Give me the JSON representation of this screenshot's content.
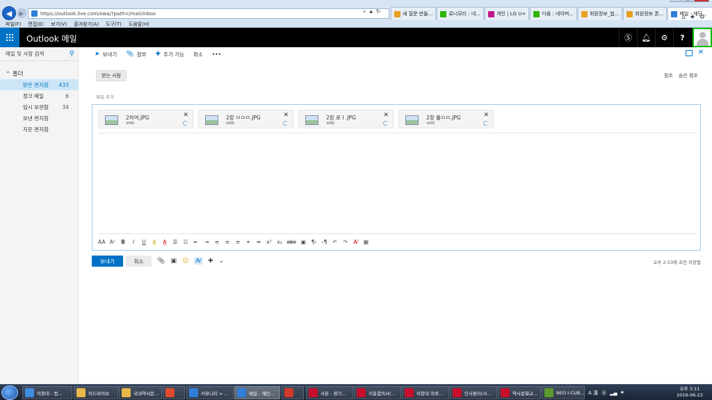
{
  "browser": {
    "url": "https://outlook.live.com/owa/?path=/mail/inbox",
    "menu": [
      "파일(F)",
      "편집(E)",
      "보기(V)",
      "즐겨찾기(A)",
      "도구(T)",
      "도움말(H)"
    ],
    "tabs": [
      {
        "label": "새 질문 만들...",
        "color": "#e8a020"
      },
      {
        "label": "로니모리 : 네...",
        "color": "#2db400"
      },
      {
        "label": "개인 | LG U+",
        "color": "#c0168b"
      },
      {
        "label": "다음 : 네이버...",
        "color": "#2db400"
      },
      {
        "label": "회원정보_법...",
        "color": "#e8a020"
      },
      {
        "label": "회원정보 폰...",
        "color": "#e8a020"
      },
      {
        "label": "메일 - 재단...",
        "color": "#2f7fd8",
        "active": true
      }
    ]
  },
  "header": {
    "title": "Outlook 메일",
    "help_label": "?"
  },
  "sidebar": {
    "search_placeholder": "메일 및 사람 검색",
    "folders_label": "폴더",
    "folders": [
      {
        "label": "받은 편지함",
        "count": "433",
        "selected": true
      },
      {
        "label": "정크 메일",
        "count": "6"
      },
      {
        "label": "임시 보관함",
        "count": "34"
      },
      {
        "label": "보낸 편지함",
        "count": ""
      },
      {
        "label": "지운 편지함",
        "count": ""
      }
    ]
  },
  "toolbar": {
    "send": "보내기",
    "attach": "첨부",
    "add_feature": "추가 기능",
    "cancel": "취소",
    "more": "•••"
  },
  "compose": {
    "to_label": "받는 사람",
    "cc": "참조",
    "bcc": "숨은 참조",
    "subject_placeholder": "제목 추가",
    "attachments": [
      {
        "name": "2차여.JPG",
        "size": "4MB"
      },
      {
        "name": "2장 ㅁㅁㅁ.JPG",
        "size": "4MB"
      },
      {
        "name": "2장 로 I .JPG",
        "size": "4MB"
      },
      {
        "name": "2장 롤ㅁㅁ.JPG",
        "size": "4MB"
      }
    ],
    "send_button": "보내기",
    "cancel_button": "취소",
    "draft_status": "오후 2:53에 초안 저장됨"
  },
  "taskbar": {
    "tasks": [
      {
        "label": "이창대 - 컴...",
        "color": "#3d8de0"
      },
      {
        "label": "이드라이브",
        "color": "#e8b84a"
      },
      {
        "label": "국내역사문...",
        "color": "#e8b84a"
      },
      {
        "label": "",
        "color": "#e04a2c"
      },
      {
        "label": "커뮤니티 > ...",
        "color": "#2f7fd8"
      },
      {
        "label": "메일 - 재단...",
        "color": "#2f7fd8",
        "active": true
      },
      {
        "label": "",
        "color": "#d43a2c"
      },
      {
        "label": "사본 - 정기...",
        "color": "#c8102e"
      },
      {
        "label": "지출결의서(...",
        "color": "#c8102e"
      },
      {
        "label": "이창대 의뢰...",
        "color": "#c8102e"
      },
      {
        "label": "인사편지(사...",
        "color": "#c8102e"
      },
      {
        "label": "역사문화교...",
        "color": "#c8102e"
      },
      {
        "label": "NEO I-CUB...",
        "color": "#5c9a2c"
      }
    ],
    "ime": "A 漢",
    "time": "오후 3:11",
    "date": "2016-06-23"
  }
}
